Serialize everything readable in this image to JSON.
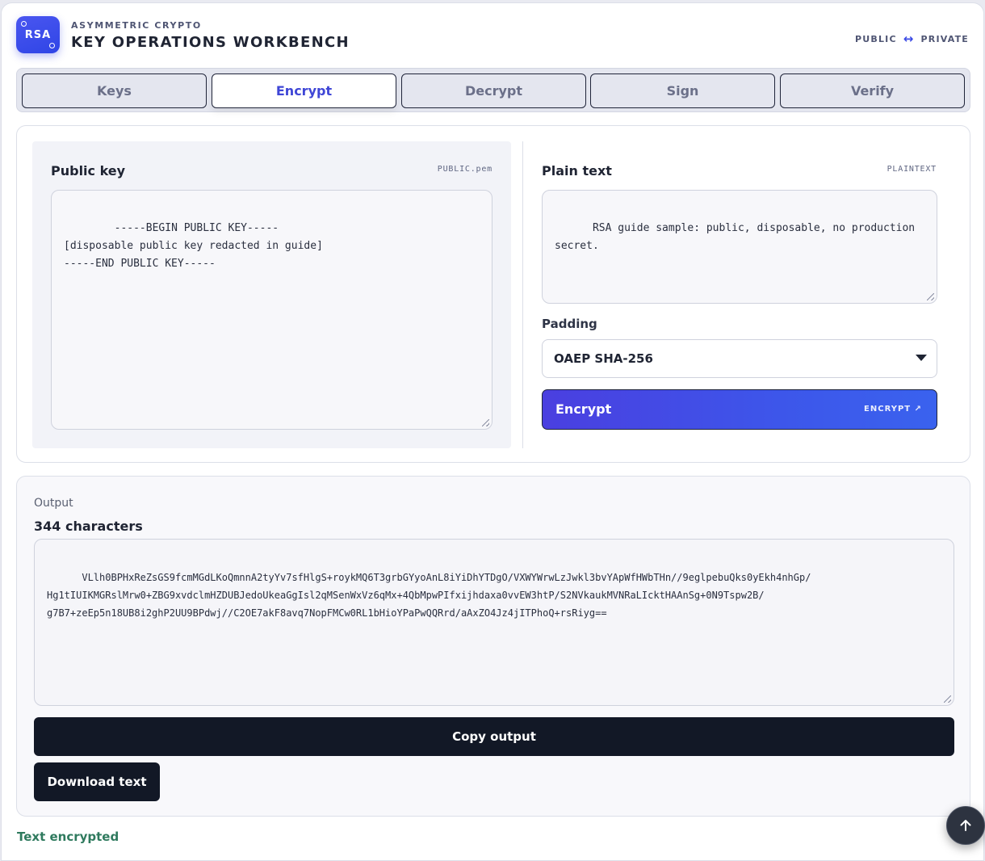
{
  "header": {
    "logo_text": "RSA",
    "eyebrow": "ASYMMETRIC CRYPTO",
    "title": "KEY OPERATIONS WORKBENCH",
    "tag_left": "PUBLIC",
    "tag_arrow": "↔",
    "tag_right": "PRIVATE"
  },
  "tabs": [
    {
      "label": "Keys",
      "active": false
    },
    {
      "label": "Encrypt",
      "active": true
    },
    {
      "label": "Decrypt",
      "active": false
    },
    {
      "label": "Sign",
      "active": false
    },
    {
      "label": "Verify",
      "active": false
    }
  ],
  "public_key": {
    "label": "Public key",
    "tag": "PUBLIC.pem",
    "value": "-----BEGIN PUBLIC KEY-----\n[disposable public key redacted in guide]\n-----END PUBLIC KEY-----"
  },
  "plain_text": {
    "label": "Plain text",
    "tag": "PLAINTEXT",
    "value": "RSA guide sample: public, disposable, no production secret."
  },
  "padding": {
    "label": "Padding",
    "selected": "OAEP SHA-256"
  },
  "encrypt_button": {
    "label": "Encrypt",
    "shortcut": "ENCRYPT ↗"
  },
  "output": {
    "caption": "Output",
    "count": "344 characters",
    "value": "VLlh0BPHxReZsGS9fcmMGdLKoQmnnA2tyYv7sfHlgS+roykMQ6T3grbGYyoAnL8iYiDhYTDgO/VXWYWrwLzJwkl3bvYApWfHWbTHn//9eglpebuQks0yEkh4nhGp/\nHg1tIUIKMGRslMrw0+ZBG9xvdclmHZDUBJedoUkeaGgIsl2qMSenWxVz6qMx+4QbMpwPIfxijhdaxa0vvEW3htP/S2NVkaukMVNRaLIcktHAAnSg+0N9Tspw2B/\ng7B7+zeEp5n18UB8i2ghP2UU9BPdwj//C2OE7akF8avq7NopFMCw0RL1bHioYPaPwQQRrd/aAxZO4Jz4jITPhoQ+rsRiyg==",
    "copy_label": "Copy output",
    "download_label": "Download text"
  },
  "status": "Text encrypted",
  "colors": {
    "accent": "#3f46d6",
    "dark_button": "#121826",
    "success": "#2f7a5e"
  },
  "icons": {
    "scroll_top": "arrow-up-icon"
  }
}
